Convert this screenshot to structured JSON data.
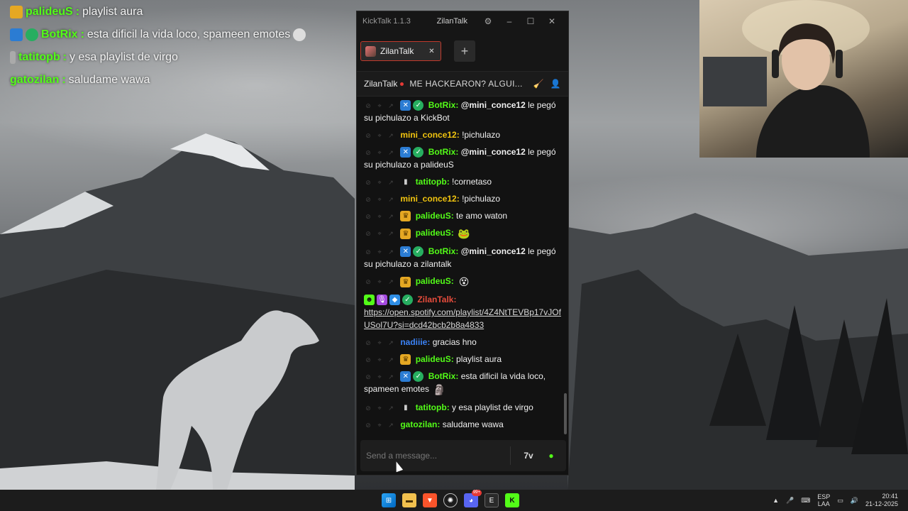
{
  "overlay": {
    "lines": [
      {
        "user": "palideuS",
        "sep": ":",
        "message": "playlist aura",
        "color": "#53fc18"
      },
      {
        "user": "BotRix",
        "sep": ":",
        "message": "esta dificil la vida loco, spameen emotes",
        "color": "#53fc18"
      },
      {
        "user": "tatitopb",
        "sep": ":",
        "message": "y esa playlist de virgo",
        "color": "#53fc18"
      },
      {
        "user": "gatozilan",
        "sep": ":",
        "message": "saludame wawa",
        "color": "#53fc18"
      }
    ]
  },
  "window": {
    "app_name": "KickTalk 1.1.3",
    "title_user": "ZilanTalk",
    "settings_icon": "gear-icon",
    "controls": {
      "minimize": "–",
      "maximize": "☐",
      "close": "✕"
    }
  },
  "tabs": [
    {
      "label": "ZilanTalk",
      "close": "✕"
    }
  ],
  "add_tab_label": "+",
  "stream": {
    "user": "ZilanTalk",
    "title": "ME HACKEARON? ALGUI...",
    "icons": [
      "broom-icon",
      "user-icon"
    ]
  },
  "messages": [
    {
      "badges": [
        "bot",
        "verified"
      ],
      "user": "BotRix",
      "sep": ":",
      "mention": "@mini_conce12",
      "text": "le pegó su pichulazo a KickBot",
      "color": "green"
    },
    {
      "badges": [],
      "user": "mini_conce12",
      "sep": ":",
      "text": "!pichulazo",
      "color": "yellow"
    },
    {
      "badges": [
        "bot",
        "verified"
      ],
      "user": "BotRix",
      "sep": ":",
      "mention": "@mini_conce12",
      "text": "le pegó su pichulazo a palideuS",
      "color": "green"
    },
    {
      "badges": [
        "glass"
      ],
      "user": "tatitopb",
      "sep": ":",
      "text": "!cornetaso",
      "color": "green"
    },
    {
      "badges": [],
      "user": "mini_conce12",
      "sep": ":",
      "text": "!pichulazo",
      "color": "yellow"
    },
    {
      "badges": [
        "crown"
      ],
      "user": "palideuS",
      "sep": ":",
      "text": "te amo waton",
      "color": "green"
    },
    {
      "badges": [
        "crown"
      ],
      "user": "palideuS",
      "sep": ":",
      "emote": "🐸",
      "color": "green"
    },
    {
      "badges": [
        "bot",
        "verified"
      ],
      "user": "BotRix",
      "sep": ":",
      "mention": "@mini_conce12",
      "text": "le pegó su pichulazo a zilantalk",
      "color": "green"
    },
    {
      "badges": [
        "crown"
      ],
      "user": "palideuS",
      "sep": ":",
      "emote": "😵",
      "color": "green"
    },
    {
      "badges": [
        "mod",
        "mic",
        "cube",
        "verified"
      ],
      "user": "ZilanTalk",
      "sep": ":",
      "link": "https://open.spotify.com/playlist/4Z4NtTEVBp17vJOfUSol7U?si=dcd42bcb2b8a4833",
      "color": "red",
      "no_actions": true
    },
    {
      "badges": [],
      "user": "nadiiie",
      "sep": ":",
      "text": "gracias hno",
      "color": "blue"
    },
    {
      "badges": [
        "crown"
      ],
      "user": "palideuS",
      "sep": ":",
      "text": "playlist aura",
      "color": "green"
    },
    {
      "badges": [
        "bot",
        "verified"
      ],
      "user": "BotRix",
      "sep": ":",
      "text": "esta dificil la vida loco, spameen emotes",
      "emote": "🗿",
      "color": "green"
    },
    {
      "badges": [
        "glass"
      ],
      "user": "tatitopb",
      "sep": ":",
      "text": "y esa playlist de virgo",
      "color": "green"
    },
    {
      "badges": [],
      "user": "gatozilan",
      "sep": ":",
      "text": "saludame wawa",
      "color": "green"
    }
  ],
  "composer": {
    "placeholder": "Send a message...",
    "icons": [
      "seventv-icon",
      "kick-emote-icon"
    ]
  },
  "taskbar": {
    "apps": [
      "windows-start-icon",
      "file-explorer-icon",
      "brave-browser-icon",
      "chatgpt-icon",
      "discord-icon",
      "epic-games-icon",
      "kicktalk-icon"
    ],
    "discord_badge": "99+",
    "tray": {
      "lang_top": "ESP",
      "lang_bottom": "LAA",
      "time": "20:41",
      "date": "21-12-2025"
    }
  },
  "colors": {
    "kick_green": "#53fc18",
    "username_yellow": "#f1c40f",
    "username_blue": "#3b82f6",
    "broadcaster_red": "#e74c3c",
    "tab_border": "#c0392b"
  }
}
